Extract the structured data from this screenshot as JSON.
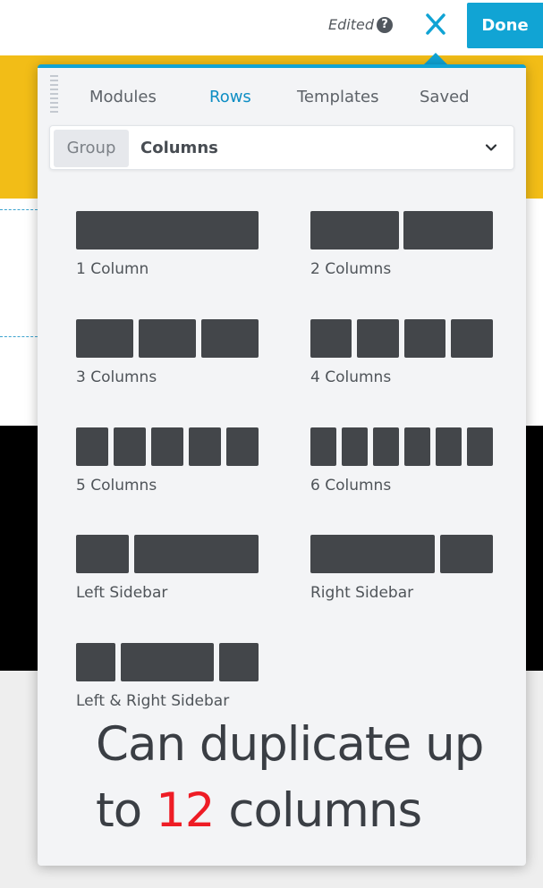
{
  "header": {
    "edited_label": "Edited",
    "help_icon": "question-circle-icon",
    "close_icon": "close-x-icon",
    "done_label": "Done"
  },
  "panel": {
    "tabs": [
      {
        "label": "Modules",
        "active": false
      },
      {
        "label": "Rows",
        "active": true
      },
      {
        "label": "Templates",
        "active": false
      },
      {
        "label": "Saved",
        "active": false
      }
    ],
    "group": {
      "label": "Group",
      "value": "Columns",
      "icon": "chevron-down-icon"
    },
    "layouts": [
      {
        "label": "1 Column"
      },
      {
        "label": "2 Columns"
      },
      {
        "label": "3 Columns"
      },
      {
        "label": "4 Columns"
      },
      {
        "label": "5 Columns"
      },
      {
        "label": "6 Columns"
      },
      {
        "label": "Left Sidebar"
      },
      {
        "label": "Right Sidebar"
      },
      {
        "label": "Left & Right Sidebar"
      }
    ]
  },
  "caption": {
    "line1": "Can duplicate up",
    "prefix": "to ",
    "number": "12",
    "suffix": " columns"
  },
  "colors": {
    "accent": "#10a3d4",
    "done_button": "#11a4d4",
    "banner_yellow": "#f2bd17",
    "block_dark": "#43464a",
    "caption_highlight": "#ee1c25"
  }
}
